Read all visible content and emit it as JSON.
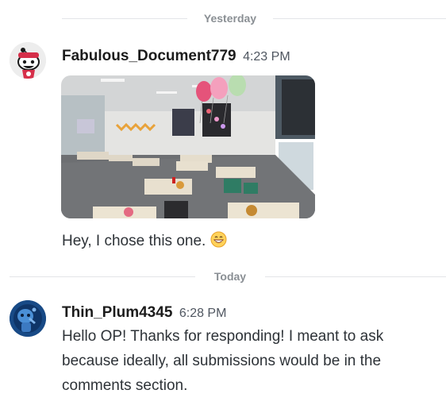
{
  "dividers": {
    "first": "Yesterday",
    "second": "Today"
  },
  "messages": [
    {
      "username": "Fabulous_Document779",
      "time": "4:23 PM",
      "avatar_icon": "snoo-avatar-icon",
      "attachment": "classroom-party-photo",
      "text": "Hey, I chose this one.",
      "emoji": "grinning-sweat-emoji"
    },
    {
      "username": "Thin_Plum4345",
      "time": "6:28 PM",
      "avatar_icon": "snoo-avatar-icon",
      "text": "Hello OP! Thanks for responding! I meant to ask because ideally, all submissions would be in the comments section."
    }
  ],
  "colors": {
    "divider_line": "#e3e5e8",
    "divider_text": "#8a8f94",
    "username": "#1c1c1c",
    "timestamp": "#4f5660"
  }
}
